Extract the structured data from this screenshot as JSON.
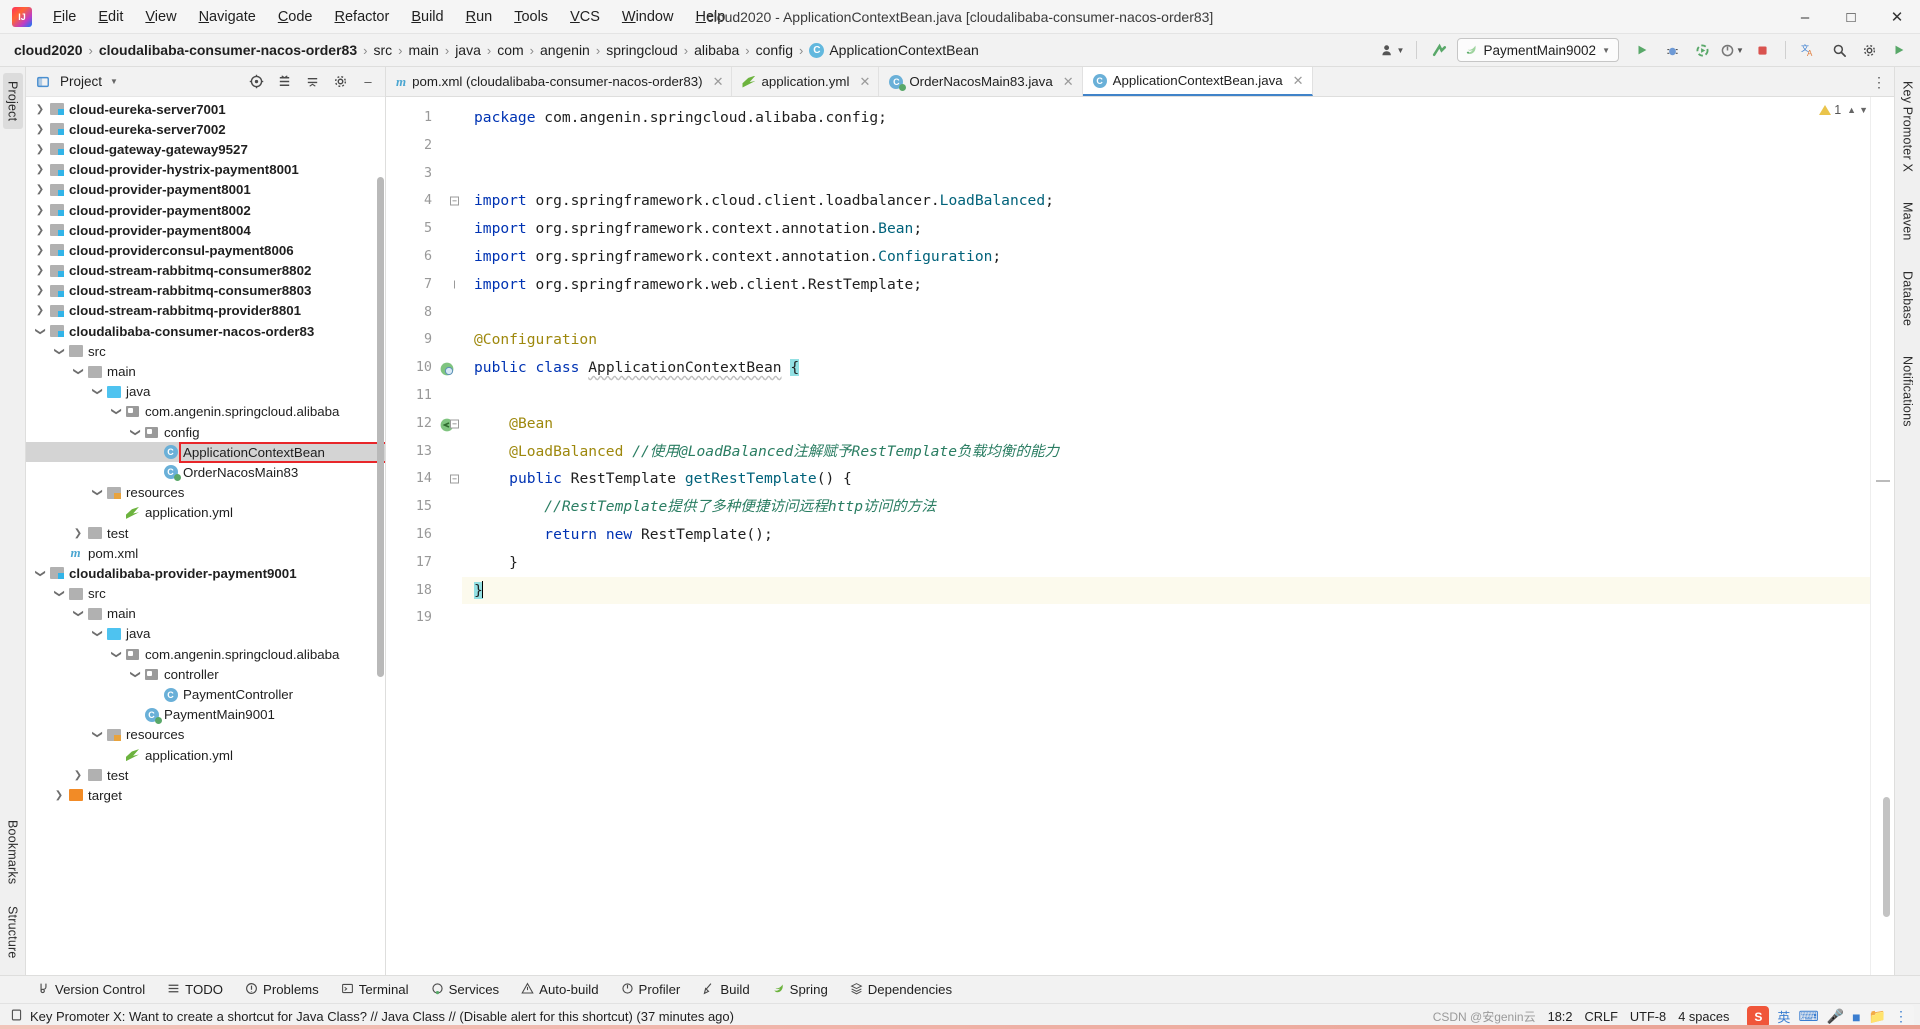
{
  "titlebar": {
    "logo": "intellij-idea-logo",
    "menus": [
      "File",
      "Edit",
      "View",
      "Navigate",
      "Code",
      "Refactor",
      "Build",
      "Run",
      "Tools",
      "VCS",
      "Window",
      "Help"
    ],
    "window_title": "cloud2020 - ApplicationContextBean.java [cloudalibaba-consumer-nacos-order83]",
    "controls": [
      "minimize",
      "maximize",
      "close"
    ]
  },
  "navbar": {
    "breadcrumbs": [
      {
        "label": "cloud2020",
        "bold": true
      },
      {
        "label": "cloudalibaba-consumer-nacos-order83",
        "bold": true
      },
      {
        "label": "src",
        "bold": false
      },
      {
        "label": "main",
        "bold": false
      },
      {
        "label": "java",
        "bold": false
      },
      {
        "label": "com",
        "bold": false
      },
      {
        "label": "angenin",
        "bold": false
      },
      {
        "label": "springcloud",
        "bold": false
      },
      {
        "label": "alibaba",
        "bold": false
      },
      {
        "label": "config",
        "bold": false
      },
      {
        "label": "ApplicationContextBean",
        "bold": false,
        "icon": "class-icon"
      }
    ],
    "run_config": "PaymentMain9002",
    "icons": [
      "user-avatar-icon",
      "updates-icon",
      "run-icon",
      "debug-icon",
      "run-with-coverage-icon",
      "profiler-icon",
      "stop-icon",
      "translate-icon",
      "search-icon",
      "settings-icon",
      "play-icon"
    ]
  },
  "left_strip": {
    "tabs": [
      {
        "label": "Project",
        "active": true
      },
      {
        "label": "Bookmarks",
        "active": false
      },
      {
        "label": "Structure",
        "active": false
      }
    ]
  },
  "right_strip": {
    "tabs": [
      "Key Promoter X",
      "Maven",
      "Database",
      "Notifications"
    ]
  },
  "project_panel": {
    "title": "Project",
    "toolbar_icons": [
      "select-opened-file-icon",
      "expand-all-icon",
      "collapse-all-icon",
      "settings-icon",
      "hide-icon"
    ],
    "tree": [
      {
        "label": "cloud-eureka-server7001",
        "depth": 1,
        "arrow": "right",
        "icon": "module-folder-icon",
        "bold": true
      },
      {
        "label": "cloud-eureka-server7002",
        "depth": 1,
        "arrow": "right",
        "icon": "module-folder-icon",
        "bold": true
      },
      {
        "label": "cloud-gateway-gateway9527",
        "depth": 1,
        "arrow": "right",
        "icon": "module-folder-icon",
        "bold": true
      },
      {
        "label": "cloud-provider-hystrix-payment8001",
        "depth": 1,
        "arrow": "right",
        "icon": "module-folder-icon",
        "bold": true
      },
      {
        "label": "cloud-provider-payment8001",
        "depth": 1,
        "arrow": "right",
        "icon": "module-folder-icon",
        "bold": true
      },
      {
        "label": "cloud-provider-payment8002",
        "depth": 1,
        "arrow": "right",
        "icon": "module-folder-icon",
        "bold": true
      },
      {
        "label": "cloud-provider-payment8004",
        "depth": 1,
        "arrow": "right",
        "icon": "module-folder-icon",
        "bold": true
      },
      {
        "label": "cloud-providerconsul-payment8006",
        "depth": 1,
        "arrow": "right",
        "icon": "module-folder-icon",
        "bold": true
      },
      {
        "label": "cloud-stream-rabbitmq-consumer8802",
        "depth": 1,
        "arrow": "right",
        "icon": "module-folder-icon",
        "bold": true
      },
      {
        "label": "cloud-stream-rabbitmq-consumer8803",
        "depth": 1,
        "arrow": "right",
        "icon": "module-folder-icon",
        "bold": true
      },
      {
        "label": "cloud-stream-rabbitmq-provider8801",
        "depth": 1,
        "arrow": "right",
        "icon": "module-folder-icon",
        "bold": true
      },
      {
        "label": "cloudalibaba-consumer-nacos-order83",
        "depth": 1,
        "arrow": "down",
        "icon": "module-folder-icon",
        "bold": true
      },
      {
        "label": "src",
        "depth": 2,
        "arrow": "down",
        "icon": "folder-icon",
        "bold": false
      },
      {
        "label": "main",
        "depth": 3,
        "arrow": "down",
        "icon": "folder-icon",
        "bold": false
      },
      {
        "label": "java",
        "depth": 4,
        "arrow": "down",
        "icon": "source-folder-icon",
        "bold": false
      },
      {
        "label": "com.angenin.springcloud.alibaba",
        "depth": 5,
        "arrow": "down",
        "icon": "package-icon",
        "bold": false
      },
      {
        "label": "config",
        "depth": 6,
        "arrow": "down",
        "icon": "package-icon",
        "bold": false
      },
      {
        "label": "ApplicationContextBean",
        "depth": 7,
        "arrow": "none",
        "icon": "class-icon",
        "bold": false,
        "selected": true,
        "highlighted": true
      },
      {
        "label": "OrderNacosMain83",
        "depth": 7,
        "arrow": "none",
        "icon": "runnable-class-icon",
        "bold": false
      },
      {
        "label": "resources",
        "depth": 4,
        "arrow": "down",
        "icon": "resources-folder-icon",
        "bold": false
      },
      {
        "label": "application.yml",
        "depth": 5,
        "arrow": "none",
        "icon": "yaml-icon",
        "bold": false
      },
      {
        "label": "test",
        "depth": 3,
        "arrow": "right",
        "icon": "folder-icon",
        "bold": false
      },
      {
        "label": "pom.xml",
        "depth": 2,
        "arrow": "none",
        "icon": "maven-icon",
        "bold": false
      },
      {
        "label": "cloudalibaba-provider-payment9001",
        "depth": 1,
        "arrow": "down",
        "icon": "module-folder-icon",
        "bold": true
      },
      {
        "label": "src",
        "depth": 2,
        "arrow": "down",
        "icon": "folder-icon",
        "bold": false
      },
      {
        "label": "main",
        "depth": 3,
        "arrow": "down",
        "icon": "folder-icon",
        "bold": false
      },
      {
        "label": "java",
        "depth": 4,
        "arrow": "down",
        "icon": "source-folder-icon",
        "bold": false
      },
      {
        "label": "com.angenin.springcloud.alibaba",
        "depth": 5,
        "arrow": "down",
        "icon": "package-icon",
        "bold": false
      },
      {
        "label": "controller",
        "depth": 6,
        "arrow": "down",
        "icon": "package-icon",
        "bold": false
      },
      {
        "label": "PaymentController",
        "depth": 7,
        "arrow": "none",
        "icon": "class-icon",
        "bold": false
      },
      {
        "label": "PaymentMain9001",
        "depth": 6,
        "arrow": "none",
        "icon": "runnable-class-icon",
        "bold": false
      },
      {
        "label": "resources",
        "depth": 4,
        "arrow": "down",
        "icon": "resources-folder-icon",
        "bold": false
      },
      {
        "label": "application.yml",
        "depth": 5,
        "arrow": "none",
        "icon": "yaml-icon",
        "bold": false
      },
      {
        "label": "test",
        "depth": 3,
        "arrow": "right",
        "icon": "folder-icon",
        "bold": false
      },
      {
        "label": "target",
        "depth": 2,
        "arrow": "right",
        "icon": "target-folder-icon",
        "bold": false
      }
    ]
  },
  "editor": {
    "tabs": [
      {
        "label": "pom.xml (cloudalibaba-consumer-nacos-order83)",
        "icon": "maven-icon",
        "active": false
      },
      {
        "label": "application.yml",
        "icon": "yaml-icon",
        "active": false
      },
      {
        "label": "OrderNacosMain83.java",
        "icon": "runnable-class-icon",
        "active": false
      },
      {
        "label": "ApplicationContextBean.java",
        "icon": "class-icon",
        "active": true
      }
    ],
    "warning_count": "1",
    "lines": [
      {
        "n": 1,
        "tokens": [
          {
            "t": "package",
            "c": "kw"
          },
          {
            "t": " com.angenin.springcloud.alibaba.config;",
            "c": "txt"
          }
        ]
      },
      {
        "n": 2,
        "tokens": []
      },
      {
        "n": 3,
        "tokens": []
      },
      {
        "n": 4,
        "fold": true,
        "tokens": [
          {
            "t": "import",
            "c": "kw"
          },
          {
            "t": " org.springframework.cloud.client.loadbalancer.",
            "c": "txt"
          },
          {
            "t": "LoadBalanced",
            "c": "mth"
          },
          {
            "t": ";",
            "c": "txt"
          }
        ]
      },
      {
        "n": 5,
        "tokens": [
          {
            "t": "import",
            "c": "kw"
          },
          {
            "t": " org.springframework.context.annotation.",
            "c": "txt"
          },
          {
            "t": "Bean",
            "c": "mth"
          },
          {
            "t": ";",
            "c": "txt"
          }
        ]
      },
      {
        "n": 6,
        "tokens": [
          {
            "t": "import",
            "c": "kw"
          },
          {
            "t": " org.springframework.context.annotation.",
            "c": "txt"
          },
          {
            "t": "Configuration",
            "c": "mth"
          },
          {
            "t": ";",
            "c": "txt"
          }
        ]
      },
      {
        "n": 7,
        "foldend": true,
        "tokens": [
          {
            "t": "import",
            "c": "kw"
          },
          {
            "t": " org.springframework.web.client.RestTemplate;",
            "c": "txt"
          }
        ]
      },
      {
        "n": 8,
        "tokens": []
      },
      {
        "n": 9,
        "tokens": [
          {
            "t": "@Configuration",
            "c": "ann"
          }
        ]
      },
      {
        "n": 10,
        "gutter_icon": "spring-bean-icon",
        "tokens": [
          {
            "t": "public",
            "c": "kw"
          },
          {
            "t": " ",
            "c": "txt"
          },
          {
            "t": "class",
            "c": "kw"
          },
          {
            "t": " ",
            "c": "txt"
          },
          {
            "t": "ApplicationContextBean",
            "c": "wavy"
          },
          {
            "t": " ",
            "c": "txt"
          },
          {
            "t": "{",
            "c": "brace-hl"
          }
        ]
      },
      {
        "n": 11,
        "tokens": []
      },
      {
        "n": 12,
        "gutter_icon": "spring-bean-method-icon",
        "fold": true,
        "tokens": [
          {
            "t": "    ",
            "c": "txt"
          },
          {
            "t": "@Bean",
            "c": "ann"
          }
        ]
      },
      {
        "n": 13,
        "tokens": [
          {
            "t": "    ",
            "c": "txt"
          },
          {
            "t": "@LoadBalanced",
            "c": "ann"
          },
          {
            "t": " ",
            "c": "txt"
          },
          {
            "t": "//使用@LoadBalanced注解赋予RestTemplate负载均衡的能力",
            "c": "cmt-ch"
          }
        ]
      },
      {
        "n": 14,
        "fold": true,
        "tokens": [
          {
            "t": "    ",
            "c": "txt"
          },
          {
            "t": "public",
            "c": "kw"
          },
          {
            "t": " RestTemplate ",
            "c": "txt"
          },
          {
            "t": "getRestTemplate",
            "c": "mth"
          },
          {
            "t": "() {",
            "c": "txt"
          }
        ]
      },
      {
        "n": 15,
        "tokens": [
          {
            "t": "        ",
            "c": "txt"
          },
          {
            "t": "//RestTemplate提供了多种便捷访问远程http访问的方法",
            "c": "cmt-ch"
          }
        ]
      },
      {
        "n": 16,
        "tokens": [
          {
            "t": "        ",
            "c": "txt"
          },
          {
            "t": "return",
            "c": "kw"
          },
          {
            "t": " ",
            "c": "txt"
          },
          {
            "t": "new",
            "c": "kw"
          },
          {
            "t": " RestTemplate();",
            "c": "txt"
          }
        ]
      },
      {
        "n": 17,
        "tokens": [
          {
            "t": "    }",
            "c": "txt"
          }
        ]
      },
      {
        "n": 18,
        "current": true,
        "cursor": true,
        "tokens": [
          {
            "t": "}",
            "c": "brace-hl"
          }
        ]
      },
      {
        "n": 19,
        "tokens": []
      }
    ]
  },
  "bottom": {
    "tool_buttons": [
      {
        "label": "Version Control",
        "icon": "branch-icon"
      },
      {
        "label": "TODO",
        "icon": "list-icon"
      },
      {
        "label": "Problems",
        "icon": "error-icon"
      },
      {
        "label": "Terminal",
        "icon": "terminal-icon"
      },
      {
        "label": "Services",
        "icon": "services-icon"
      },
      {
        "label": "Auto-build",
        "icon": "warning-icon"
      },
      {
        "label": "Profiler",
        "icon": "profiler-icon"
      },
      {
        "label": "Build",
        "icon": "hammer-icon"
      },
      {
        "label": "Spring",
        "icon": "spring-leaf-icon"
      },
      {
        "label": "Dependencies",
        "icon": "layers-icon"
      }
    ],
    "status_message": "Key Promoter X: Want to create a shortcut for Java Class? // Java Class // (Disable alert for this shortcut) (37 minutes ago)",
    "status_icon": "notification-icon",
    "caret_position": "18:2",
    "line_separator": "CRLF",
    "encoding": "UTF-8",
    "indent": "4 spaces",
    "watermark": "CSDN @安genin云",
    "ime": {
      "logo": "S",
      "lang": "英",
      "icons": [
        "keyboard-icon",
        "mic-icon",
        "box-icon",
        "folder-icon",
        "more-icon"
      ]
    }
  },
  "colors": {
    "accent": "#4083c9",
    "selection": "#d4d4d4",
    "highlight_red": "#e8262a",
    "keyword": "#0033b3",
    "annotation": "#9e880d",
    "comment_cn": "#2a7d62",
    "method": "#00627a",
    "brace_highlight": "#93e0e3"
  }
}
